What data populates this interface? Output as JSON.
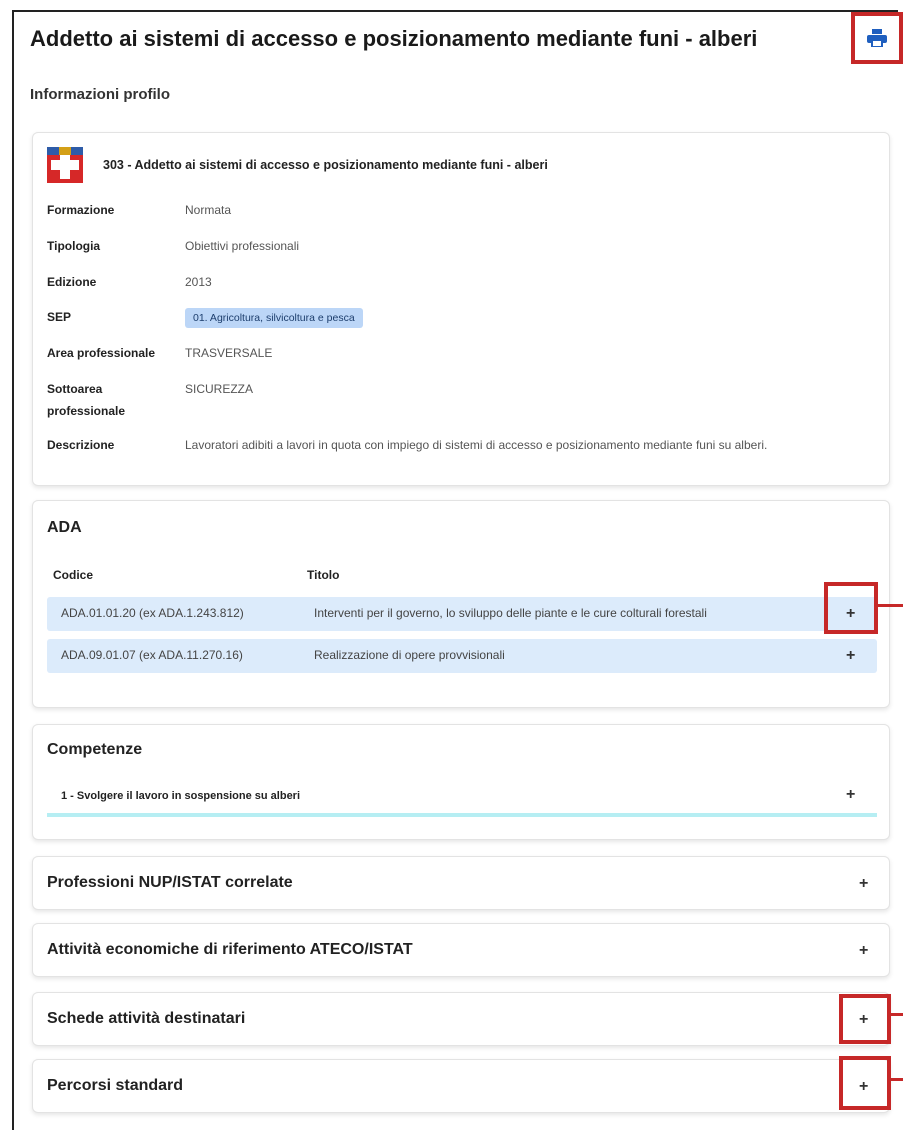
{
  "page": {
    "title": "Addetto ai sistemi di accesso e posizionamento mediante funi - alberi",
    "subtitle": "Informazioni profilo",
    "print_icon": "printer-icon"
  },
  "profile": {
    "code_title": "303 - Addetto ai sistemi di accesso e posizionamento mediante funi - alberi",
    "rows": [
      {
        "label": "Formazione",
        "value": "Normata"
      },
      {
        "label": "Tipologia",
        "value": "Obiettivi professionali"
      },
      {
        "label": "Edizione",
        "value": "2013"
      },
      {
        "label": "SEP",
        "value": "01. Agricoltura, silvicoltura e pesca"
      },
      {
        "label": "Area professionale",
        "value": "TRASVERSALE"
      },
      {
        "label": "Sottoarea professionale",
        "value": "SICUREZZA"
      },
      {
        "label": "Descrizione",
        "value": "Lavoratori adibiti a lavori in quota con impiego di sistemi di accesso e posizionamento mediante funi su alberi."
      }
    ]
  },
  "ada": {
    "title": "ADA",
    "col_code": "Codice",
    "col_title": "Titolo",
    "rows": [
      {
        "code": "ADA.01.01.20 (ex ADA.1.243.812)",
        "title": "Interventi per il governo, lo sviluppo delle piante e le cure colturali forestali",
        "toggle": "+"
      },
      {
        "code": "ADA.09.01.07 (ex ADA.11.270.16)",
        "title": "Realizzazione di opere provvisionali",
        "toggle": "+"
      }
    ]
  },
  "competenze": {
    "title": "Competenze",
    "items": [
      {
        "label": "1 - Svolgere il lavoro in sospensione su alberi",
        "toggle": "+"
      }
    ]
  },
  "sections": [
    {
      "title": "Professioni NUP/ISTAT correlate",
      "toggle": "+"
    },
    {
      "title": "Attività economiche di riferimento ATECO/ISTAT",
      "toggle": "+"
    },
    {
      "title": "Schede attività destinatari",
      "toggle": "+"
    },
    {
      "title": "Percorsi standard",
      "toggle": "+"
    }
  ],
  "colors": {
    "highlight": "#c62828",
    "accent_blue": "#1f5fbf",
    "row_bg": "#dcebfb",
    "sep_badge": "#bcd6f7"
  }
}
